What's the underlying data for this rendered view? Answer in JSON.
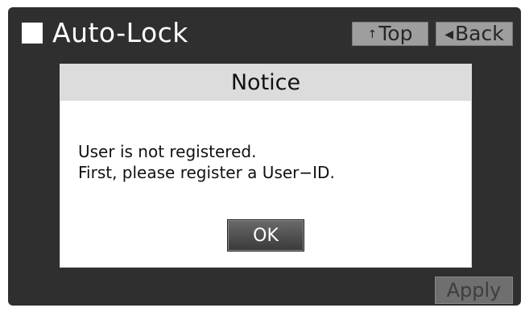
{
  "header": {
    "title": "Auto-Lock",
    "top_button": {
      "icon": "up-arrow-icon",
      "label": "Top"
    },
    "back_button": {
      "icon": "left-triangle-icon",
      "label": "Back"
    }
  },
  "dialog": {
    "title": "Notice",
    "message_lines": [
      "User is not registered.",
      "First, please register a User−ID."
    ],
    "ok_label": "OK"
  },
  "footer": {
    "apply_label": "Apply"
  },
  "colors": {
    "screen_background": "#2f2f2f",
    "dialog_header": "#dcdcdc",
    "header_button": "#9e9e9e",
    "apply_disabled": "#6f6f6f"
  }
}
